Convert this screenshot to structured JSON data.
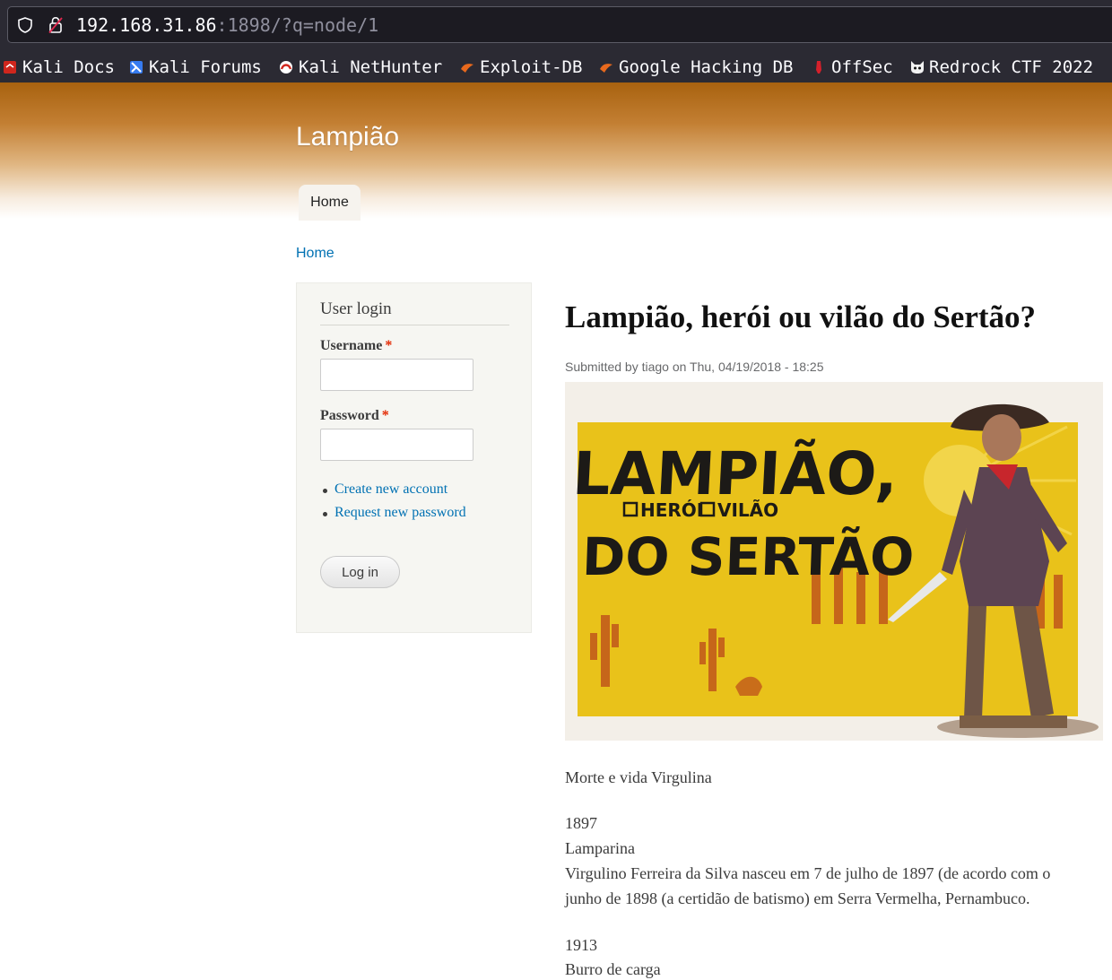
{
  "browser": {
    "url_host": "192.168.31.86",
    "url_path": ":1898/?q=node/1",
    "bookmarks": [
      {
        "label": "Kali Docs",
        "icon": "kali-docs-icon"
      },
      {
        "label": "Kali Forums",
        "icon": "kali-forums-icon"
      },
      {
        "label": "Kali NetHunter",
        "icon": "kali-nethunter-icon"
      },
      {
        "label": "Exploit-DB",
        "icon": "exploit-db-icon"
      },
      {
        "label": "Google Hacking DB",
        "icon": "ghdb-icon"
      },
      {
        "label": "OffSec",
        "icon": "offsec-icon"
      },
      {
        "label": "Redrock CTF 2022",
        "icon": "redrock-icon"
      }
    ]
  },
  "site": {
    "name": "Lampião",
    "nav": {
      "home_tab": "Home"
    },
    "breadcrumb": "Home"
  },
  "login_block": {
    "title": "User login",
    "username_label": "Username",
    "password_label": "Password",
    "required_mark": "*",
    "links": [
      "Create new account",
      "Request new password"
    ],
    "login_button": "Log in"
  },
  "article": {
    "title": "Lampião, herói ou vilão do Sertão?",
    "submitted": "Submitted by tiago on Thu, 04/19/2018 - 18:25",
    "image": {
      "line1": "LAMPIÃO,",
      "option1": "HERÓI",
      "option2": "VILÃO",
      "line2": "DO SERTÃO"
    },
    "paragraphs": {
      "p1": "Morte e vida Virgulina",
      "y1897": "1897",
      "h1897": "Lamparina",
      "t1897a": "Virgulino Ferreira da Silva nasceu em 7 de julho de 1897 (de acordo com o",
      "t1897b": "junho de 1898 (a certidão de batismo) em Serra Vermelha, Pernambuco.",
      "y1913": "1913",
      "h1913": "Burro de carga"
    }
  },
  "colors": {
    "header_dark": "#a8620f",
    "link": "#0071b3",
    "required": "#e32700",
    "sidebar_bg": "#f6f6f2",
    "poster_yellow": "#e9c21a"
  }
}
